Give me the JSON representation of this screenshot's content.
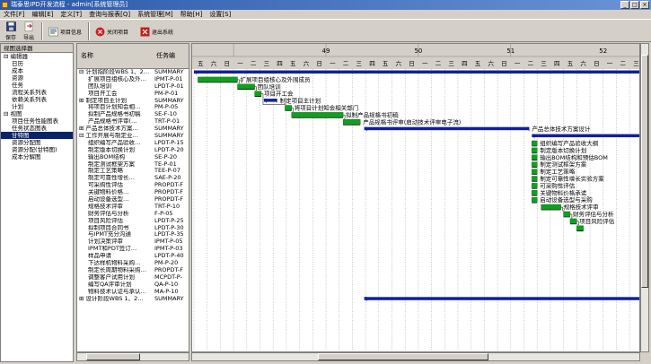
{
  "window": {
    "title": "瑞泰思IPD开发流程 - admin[系统管理员]"
  },
  "menu": [
    "文件[F]",
    "编辑[E]",
    "定义[T]",
    "查询与报表[Q]",
    "系统管理[M]",
    "帮助[H]",
    "设置[S]"
  ],
  "toolbar": {
    "save": "保存",
    "export": "导出",
    "project_info": "项目信息",
    "close_project": "关闭项目",
    "exit": "退出系统"
  },
  "left_panel": {
    "title": "视图选择器",
    "items": [
      {
        "label": "编辑器",
        "level": 0
      },
      {
        "label": "日历",
        "level": 1
      },
      {
        "label": "成本",
        "level": 1
      },
      {
        "label": "资源",
        "level": 1
      },
      {
        "label": "任务",
        "level": 1
      },
      {
        "label": "流程关系列表",
        "level": 1
      },
      {
        "label": "依赖关系列表",
        "level": 1
      },
      {
        "label": "计划",
        "level": 1
      },
      {
        "label": "视图",
        "level": 0
      },
      {
        "label": "项目任务性能图表",
        "level": 1
      },
      {
        "label": "任务状态图表",
        "level": 1
      },
      {
        "label": "甘特图",
        "level": 1,
        "selected": true
      },
      {
        "label": "资源分配图",
        "level": 1
      },
      {
        "label": "资源分配(甘特图)",
        "level": 1
      },
      {
        "label": "成本分解图",
        "level": 1
      }
    ]
  },
  "grid": {
    "col_name": "名称",
    "col_code": "任务编",
    "rows": [
      {
        "name": "⊟ 计划指阶段WBS 1、2…",
        "code": "SUMMARY"
      },
      {
        "name": "扩展项目组核心及外…",
        "code": "IPMT-P-01"
      },
      {
        "name": "团队培训",
        "code": "LPDT-P-01"
      },
      {
        "name": "项目开工会",
        "code": "PM-P-01"
      },
      {
        "name": "⊞ 制定项目主计划",
        "code": "SUMMARY"
      },
      {
        "name": "将项目计划知会相…",
        "code": "PM-P-05"
      },
      {
        "name": "拟制产品规格书初稿",
        "code": "SE-F-10"
      },
      {
        "name": "产品规格书评审(…",
        "code": "TRT-P-01"
      },
      {
        "name": "⊞ 产品总体技术方案…",
        "code": "SUMMARY"
      },
      {
        "name": "⊟ 工作开展与制定业…",
        "code": "SUMMARY"
      },
      {
        "name": "组织编写产品验收…",
        "code": "LPDT-P-15"
      },
      {
        "name": "制定版本切换计划",
        "code": "LPDT-P-20"
      },
      {
        "name": "输出BOM结构",
        "code": "SE-P-20"
      },
      {
        "name": "制定测试框架方案",
        "code": "TE-P-01"
      },
      {
        "name": "制定工艺策略",
        "code": "TEE-P-07"
      },
      {
        "name": "制定可靠性增长…",
        "code": "SAE-P-20"
      },
      {
        "name": "可采购性评估",
        "code": "PROPDT-F"
      },
      {
        "name": "关键物料价格…",
        "code": "PROPDT-F"
      },
      {
        "name": "启动设备选型…",
        "code": "PROPDT-F"
      },
      {
        "name": "规格技术评审",
        "code": "TRT-P-10"
      },
      {
        "name": "财务评估与分析",
        "code": "F-P-05"
      },
      {
        "name": "项目风险评估",
        "code": "LPDT-P-25"
      },
      {
        "name": "拟制项目合同书",
        "code": "LPDT-P-30"
      },
      {
        "name": "与IPMT充分沟通",
        "code": "LPDT-P-35"
      },
      {
        "name": "计划决策评审",
        "code": "IPMT-P-05"
      },
      {
        "name": "IPMT和PDT签订…",
        "code": "IPMT-P-03"
      },
      {
        "name": "样品申请",
        "code": "LPDT-P-40"
      },
      {
        "name": "下达样机物料采购…",
        "code": "PM-P-20"
      },
      {
        "name": "制定长周期物料采购…",
        "code": "PROPDT-F"
      },
      {
        "name": "调整客户试用计划",
        "code": "MCPDT-P-"
      },
      {
        "name": "编写QA评审计划",
        "code": "QA-P-10"
      },
      {
        "name": "物料技术认证与承认…",
        "code": "MA-P-10"
      },
      {
        "name": "⊞ 设计阶段WBS 1、2…",
        "code": "SUMMARY"
      }
    ]
  },
  "chart_data": {
    "type": "gantt",
    "weeks": [
      "49",
      "50",
      "51",
      "52"
    ],
    "day_labels": [
      "五",
      "六",
      "日",
      "一",
      "二",
      "三",
      "四",
      "五",
      "六",
      "日",
      "一",
      "二",
      "三",
      "四",
      "五",
      "六",
      "日",
      "一",
      "二",
      "三",
      "四",
      "五",
      "六",
      "日",
      "一",
      "二",
      "三",
      "四",
      "五",
      "六",
      "日",
      "一",
      "二",
      "三"
    ],
    "tasks": [
      {
        "row": 0,
        "start": 0,
        "end": 34,
        "kind": "summary",
        "label": ""
      },
      {
        "row": 1,
        "start": 0.3,
        "end": 3.3,
        "kind": "task",
        "label": "扩展项目组核心及外围成员"
      },
      {
        "row": 2,
        "start": 3.3,
        "end": 4.6,
        "kind": "task",
        "label": "团队培训"
      },
      {
        "row": 3,
        "start": 4.6,
        "end": 5.1,
        "kind": "task",
        "label": "项目开工会"
      },
      {
        "row": 4,
        "start": 5.3,
        "end": 6.3,
        "kind": "summary",
        "label": "制定项目主计划"
      },
      {
        "row": 5,
        "start": 6.9,
        "end": 7.4,
        "kind": "task",
        "label": "将项目计划知会相关部门"
      },
      {
        "row": 6,
        "start": 7.4,
        "end": 11.3,
        "kind": "task",
        "label": "拟制产品规格书初稿"
      },
      {
        "row": 7,
        "start": 11.3,
        "end": 12.6,
        "kind": "task",
        "label": "产品规格书评审(启动技术评审电子流)"
      },
      {
        "row": 8,
        "start": 12.9,
        "end": 25.4,
        "kind": "summary",
        "label": "产品总体技术方案设计"
      },
      {
        "row": 9,
        "start": 25.6,
        "end": 34,
        "kind": "summary",
        "label": "工作开展与制定业务计划"
      },
      {
        "row": 10,
        "start": 25.6,
        "end": 26.0,
        "kind": "task",
        "label": "组织编写产品验收大纲"
      },
      {
        "row": 11,
        "start": 25.6,
        "end": 26.0,
        "kind": "task",
        "label": "制定版本切换计划"
      },
      {
        "row": 12,
        "start": 25.6,
        "end": 26.0,
        "kind": "task",
        "label": "输出BOM结构和预估BOM"
      },
      {
        "row": 13,
        "start": 25.6,
        "end": 26.0,
        "kind": "task",
        "label": "制定测试框架方案"
      },
      {
        "row": 14,
        "start": 25.6,
        "end": 26.0,
        "kind": "task",
        "label": "制定工艺策略"
      },
      {
        "row": 15,
        "start": 25.6,
        "end": 26.0,
        "kind": "task",
        "label": "制定可靠性增长实验方案"
      },
      {
        "row": 16,
        "start": 25.6,
        "end": 26.0,
        "kind": "task",
        "label": "可采购性评估"
      },
      {
        "row": 17,
        "start": 25.6,
        "end": 26.0,
        "kind": "task",
        "label": "关键物料价格承诺"
      },
      {
        "row": 18,
        "start": 25.6,
        "end": 26.0,
        "kind": "task",
        "label": "启动设备选型与采购"
      },
      {
        "row": 19,
        "start": 26.3,
        "end": 27.8,
        "kind": "task",
        "label": "规格技术评审"
      },
      {
        "row": 20,
        "start": 28.0,
        "end": 28.5,
        "kind": "task",
        "label": "财务评估与分析"
      },
      {
        "row": 21,
        "start": 28.5,
        "end": 29.0,
        "kind": "task",
        "label": "项目风险评估"
      },
      {
        "row": 22,
        "start": 29.0,
        "end": 29.5,
        "kind": "task",
        "label": ""
      },
      {
        "row": 32,
        "start": 12.9,
        "end": 34,
        "kind": "summary",
        "label": ""
      }
    ]
  }
}
